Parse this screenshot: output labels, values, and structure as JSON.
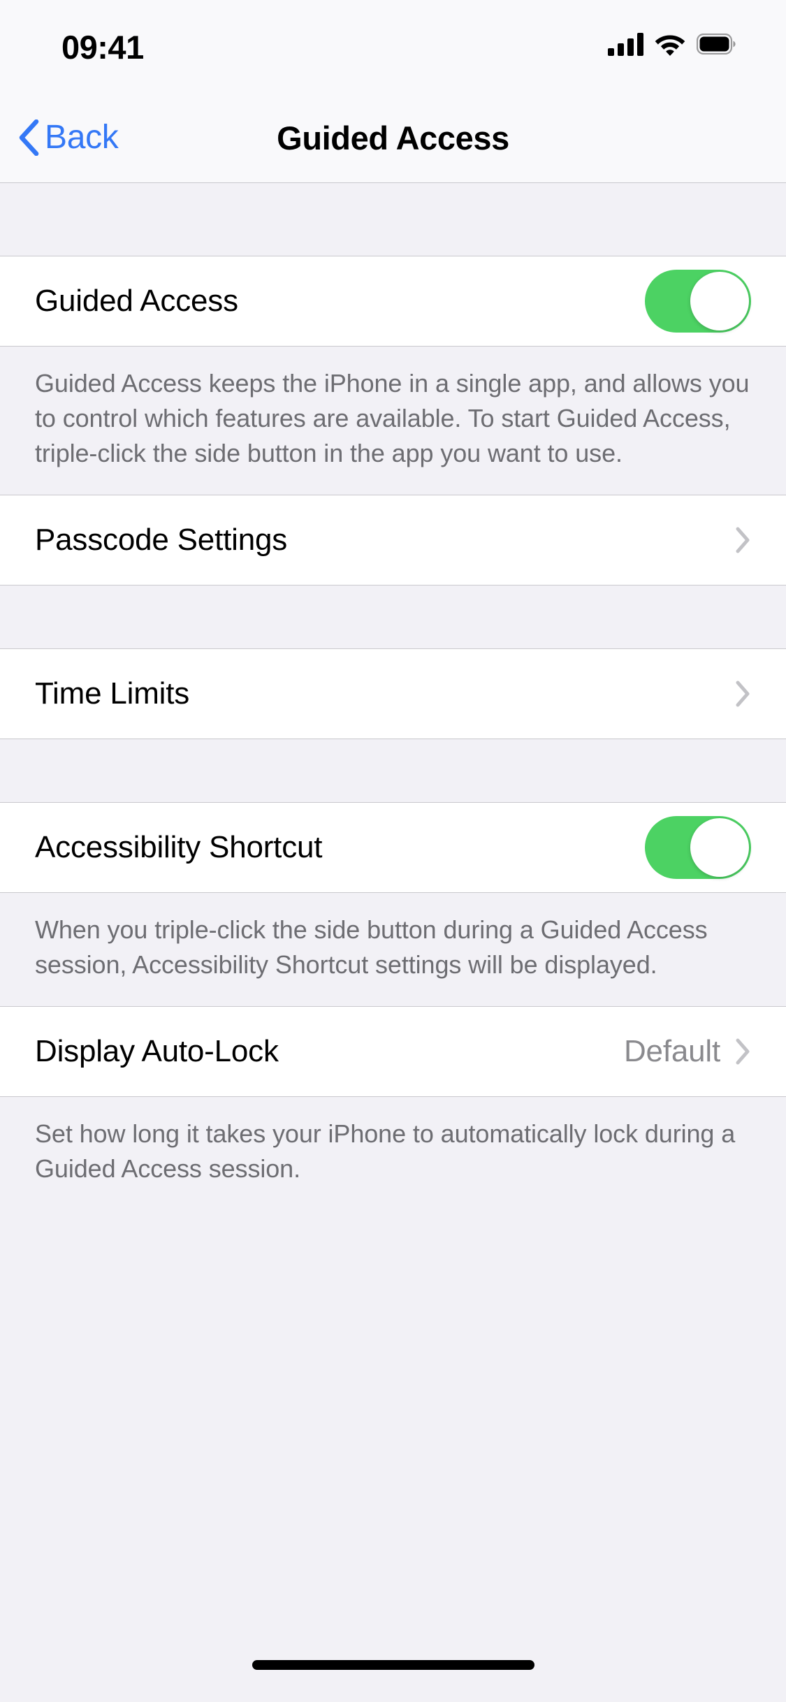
{
  "status_bar": {
    "time": "09:41",
    "icons": [
      "signal-bars-icon",
      "wifi-icon",
      "battery-icon"
    ],
    "signal_bars_filled": 4,
    "battery_full": true
  },
  "nav_bar": {
    "back_label": "Back",
    "back_icon": "chevron-left-icon",
    "title": "Guided Access"
  },
  "sections": [
    {
      "rows": [
        {
          "label": "Guided Access",
          "type": "toggle",
          "value": "on"
        }
      ],
      "footer": "Guided Access keeps the iPhone in a single app, and allows you to control which features are available. To start Guided Access, triple-click the side button in the app you want to use."
    },
    {
      "rows": [
        {
          "label": "Passcode Settings",
          "type": "disclosure",
          "value": ""
        }
      ],
      "footer": ""
    },
    {
      "rows": [
        {
          "label": "Time Limits",
          "type": "disclosure",
          "value": ""
        }
      ],
      "footer": ""
    },
    {
      "rows": [
        {
          "label": "Accessibility Shortcut",
          "type": "toggle",
          "value": "on"
        }
      ],
      "footer": "When you triple-click the side button during a Guided Access session, Accessibility Shortcut settings will be displayed."
    },
    {
      "rows": [
        {
          "label": "Display Auto-Lock",
          "type": "disclosure-value",
          "value": "Default"
        }
      ],
      "footer": "Set how long it takes your iPhone to automatically lock during a Guided Access session."
    }
  ],
  "colors": {
    "toggle_on": "#4CD263",
    "accent_blue": "#3478F6",
    "group_background": "#F2F1F6",
    "row_background": "#FFFFFF",
    "footer_text": "#6D6D72",
    "secondary_value": "#8A8A8E",
    "separator": "#C9C8CD"
  },
  "home_indicator": "home-indicator"
}
